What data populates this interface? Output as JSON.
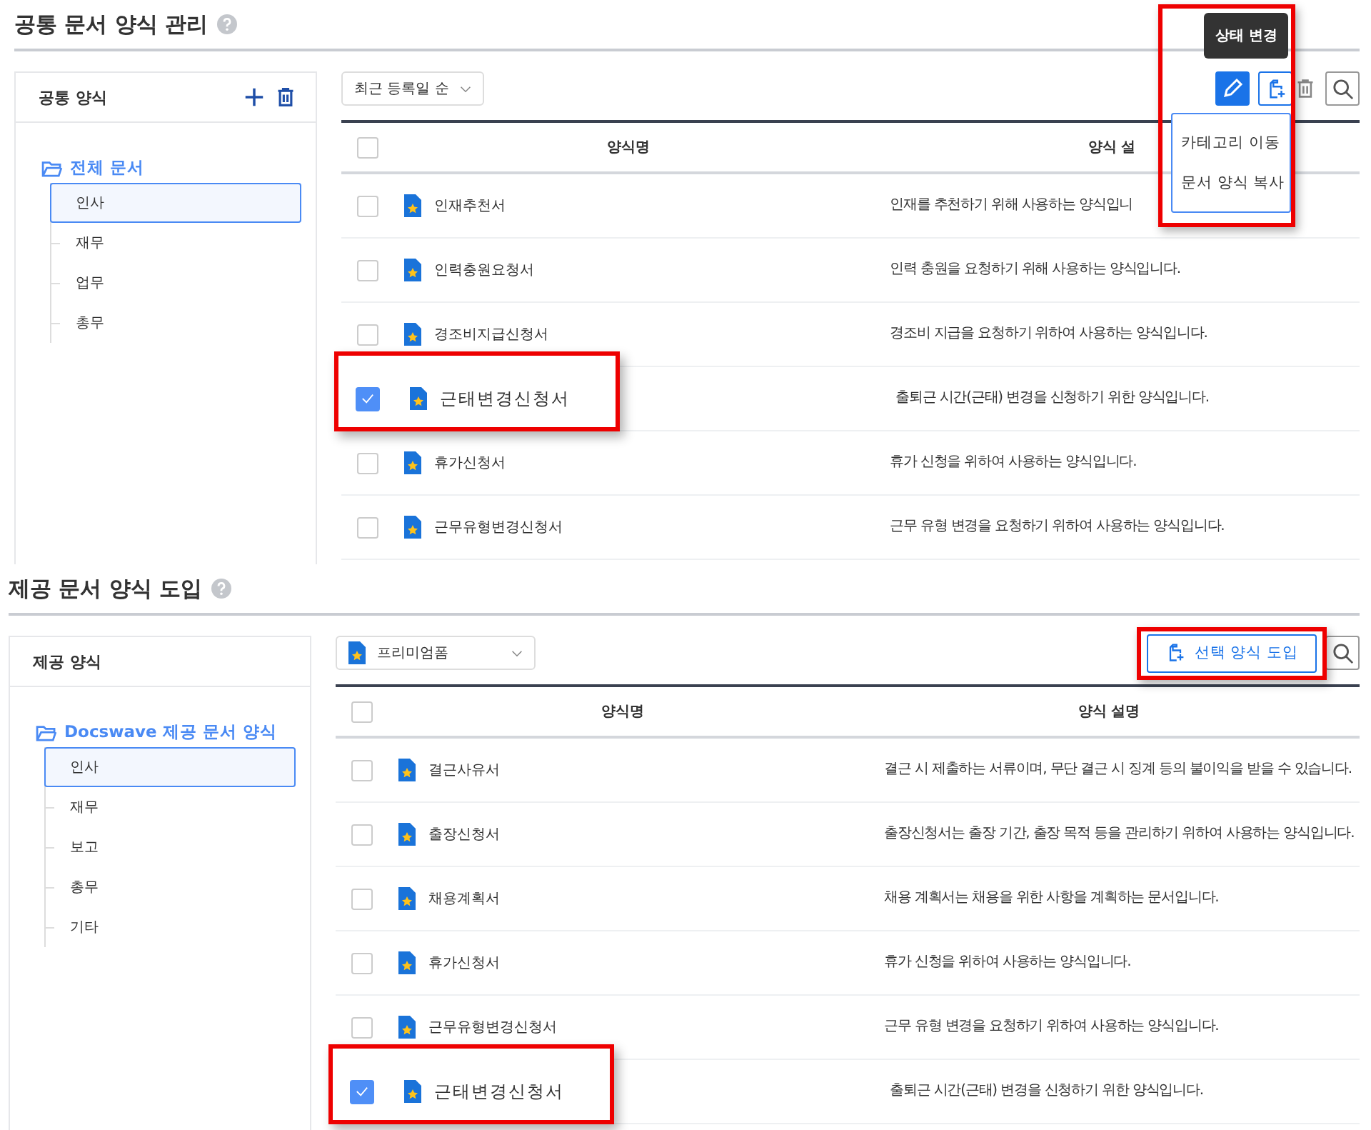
{
  "sections": [
    {
      "title": "공통 문서 양식 관리",
      "panel": {
        "title": "공통 양식",
        "tools": [
          {
            "kind": "add"
          },
          {
            "kind": "delete"
          }
        ],
        "tree": {
          "label": "전체 문서",
          "children": [
            {
              "label": "인사",
              "selected": true
            },
            {
              "label": "재무",
              "selected": false
            },
            {
              "label": "업무",
              "selected": false
            },
            {
              "label": "총무",
              "selected": false
            }
          ]
        }
      },
      "filter": {
        "kind": "sort",
        "value": "최근 등록일 순"
      },
      "toolbar": {
        "highlighted": true,
        "actions": [
          {
            "kind": "edit",
            "selected": true,
            "tooltip": "상태 변경"
          },
          {
            "kind": "copy",
            "selected": false
          },
          {
            "kind": "delete",
            "selected": false
          },
          {
            "kind": "search",
            "selected": false
          }
        ],
        "menu": [
          "카테고리 이동",
          "문서 양식 복사"
        ]
      },
      "select_all": {
        "checked": false
      },
      "columns": [
        "양식명",
        "양식 설"
      ],
      "rows": [
        {
          "name": "인재추천서",
          "description": "인재를 추천하기 위해 사용하는 양식입니",
          "checked": false,
          "highlighted": false
        },
        {
          "name": "인력충원요청서",
          "description": "인력 충원을 요청하기 위해 사용하는 양식입니다.",
          "checked": false,
          "highlighted": false
        },
        {
          "name": "경조비지급신청서",
          "description": "경조비 지급을 요청하기 위하여 사용하는 양식입니다.",
          "checked": false,
          "highlighted": false
        },
        {
          "name": "근태변경신청서",
          "description": "출퇴근 시간(근태) 변경을 신청하기 위한 양식입니다.",
          "checked": true,
          "highlighted": true
        },
        {
          "name": "휴가신청서",
          "description": "휴가 신청을 위하여 사용하는 양식입니다.",
          "checked": false,
          "highlighted": false
        },
        {
          "name": "근무유형변경신청서",
          "description": "근무 유형 변경을 요청하기 위하여 사용하는 양식입니다.",
          "checked": false,
          "highlighted": false
        }
      ]
    },
    {
      "title": "제공 문서 양식 도입",
      "panel": {
        "title": "제공 양식",
        "tree": {
          "label": "Docswave 제공 문서 양식",
          "children": [
            {
              "label": "인사",
              "selected": true
            },
            {
              "label": "재무",
              "selected": false
            },
            {
              "label": "보고",
              "selected": false
            },
            {
              "label": "총무",
              "selected": false
            },
            {
              "label": "기타",
              "selected": false
            }
          ]
        }
      },
      "filter": {
        "kind": "form",
        "value": "프리미엄폼"
      },
      "toolbar": {
        "actions": [
          {
            "kind": "import",
            "label": "선택 양식 도입",
            "selected": false,
            "highlighted": true
          },
          {
            "kind": "search",
            "selected": false
          }
        ]
      },
      "select_all": {
        "checked": false
      },
      "columns": [
        "양식명",
        "양식 설명"
      ],
      "rows": [
        {
          "name": "결근사유서",
          "description": "결근 시 제출하는 서류이며, 무단 결근 시 징계 등의 불이익을 받을 수 있습니다.",
          "checked": false,
          "highlighted": false
        },
        {
          "name": "출장신청서",
          "description": "출장신청서는 출장 기간, 출장 목적 등을 관리하기 위하여 사용하는 양식입니다.",
          "checked": false,
          "highlighted": false
        },
        {
          "name": "채용계획서",
          "description": "채용 계획서는 채용을 위한 사항을 계획하는 문서입니다.",
          "checked": false,
          "highlighted": false
        },
        {
          "name": "휴가신청서",
          "description": "휴가 신청을 위하여 사용하는 양식입니다.",
          "checked": false,
          "highlighted": false
        },
        {
          "name": "근무유형변경신청서",
          "description": "근무 유형 변경을 요청하기 위하여 사용하는 양식입니다.",
          "checked": false,
          "highlighted": false
        },
        {
          "name": "근태변경신청서",
          "description": "출퇴근 시간(근태) 변경을 신청하기 위한 양식입니다.",
          "checked": true,
          "highlighted": true
        }
      ]
    }
  ]
}
